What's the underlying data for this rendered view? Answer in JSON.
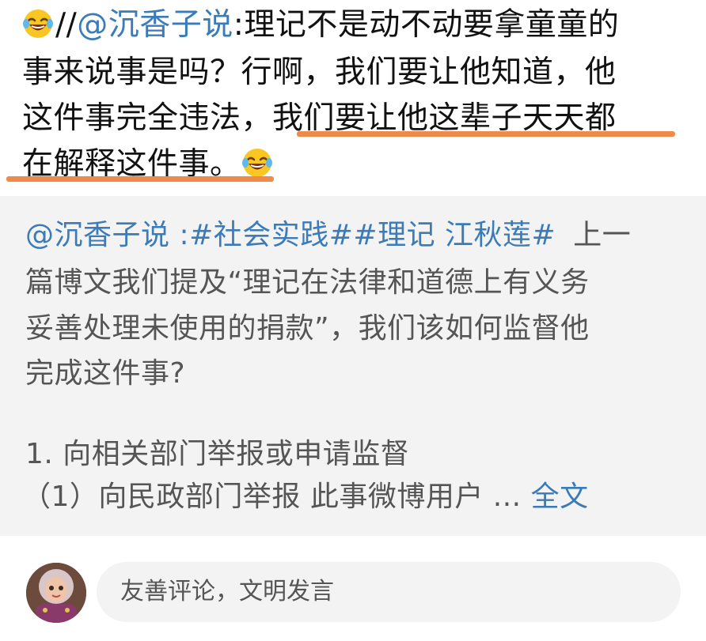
{
  "repost": {
    "line1": {
      "prefix": "//",
      "mention": "@沉香子说",
      "text": ":理记不是动不动要拿童童的"
    },
    "line2": "事来说事是吗？行啊，我们要让他知道，他",
    "line3a": "这件事完全违法，",
    "line3b": "我们要让他这辈子天天都",
    "line4": "在解释这件事。",
    "emoji_name": "laughing-tears-emoji"
  },
  "quote": {
    "mention": "@沉香子说",
    "colon": " :",
    "topics": "#社会实践##理记 江秋莲#",
    "line1_tail": "上一",
    "line2": "篇博文我们提及“理记在法律和道德上有义务",
    "line3": "妥善处理未使用的捐款”，我们该如何监督他",
    "line4": "完成这件事?",
    "line6": "1. 向相关部门举报或申请监督",
    "line7": "（1）向民政部门举报 此事微博用户 ...",
    "full_text_link": "全文"
  },
  "comment": {
    "placeholder": "友善评论，文明发言"
  },
  "colors": {
    "link": "#3a7bb8",
    "highlight_underline": "#ee8a4a",
    "quote_background": "#f3f3f3"
  }
}
